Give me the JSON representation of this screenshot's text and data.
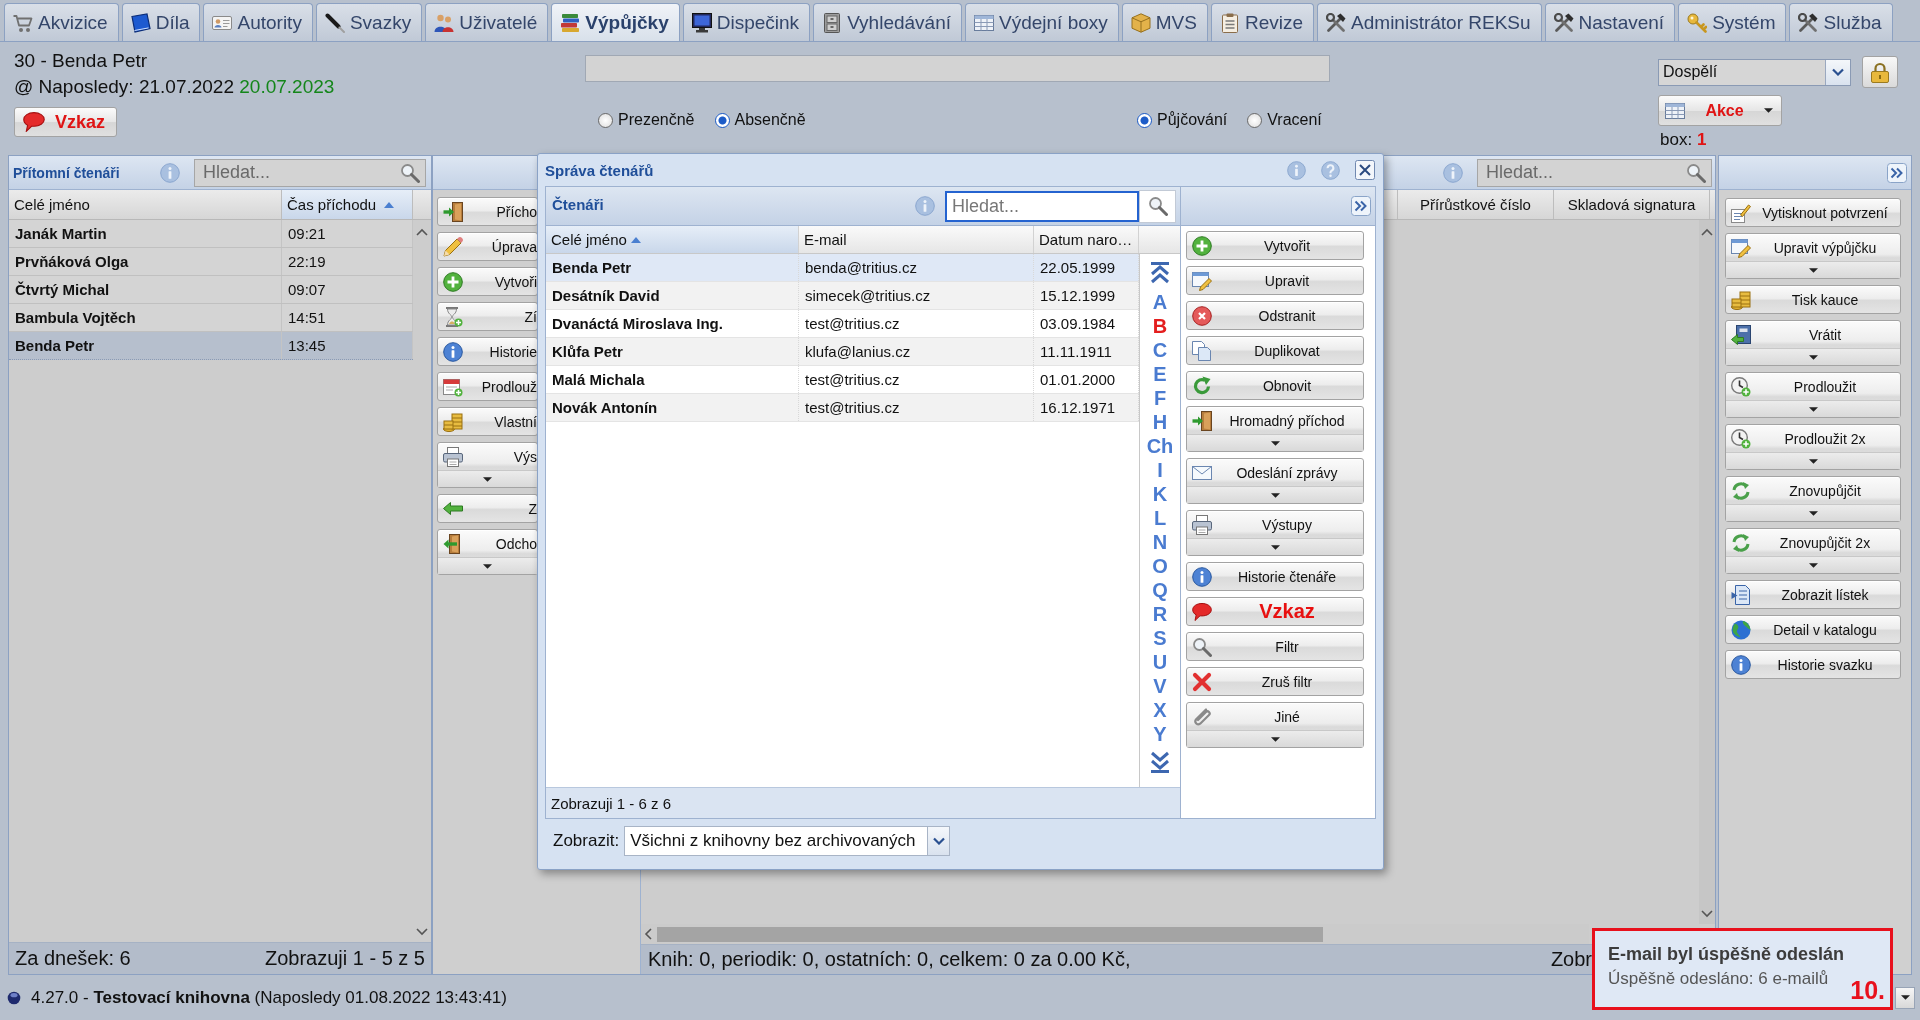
{
  "tabs": [
    {
      "label": "Akvizice",
      "selected": false
    },
    {
      "label": "Díla",
      "selected": false
    },
    {
      "label": "Autority",
      "selected": false
    },
    {
      "label": "Svazky",
      "selected": false
    },
    {
      "label": "Uživatelé",
      "selected": false
    },
    {
      "label": "Výpůjčky",
      "selected": true
    },
    {
      "label": "Dispečink",
      "selected": false
    },
    {
      "label": "Vyhledávání",
      "selected": false
    },
    {
      "label": "Výdejní boxy",
      "selected": false
    },
    {
      "label": "MVS",
      "selected": false
    },
    {
      "label": "Revize",
      "selected": false
    },
    {
      "label": "Administrátor REKSu",
      "selected": false
    },
    {
      "label": "Nastavení",
      "selected": false
    },
    {
      "label": "Systém",
      "selected": false
    },
    {
      "label": "Služba",
      "selected": false
    }
  ],
  "header": {
    "reader": "30 - Benda Petr",
    "last_visit": "@ Naposledy: 21.07.2022",
    "valid_until": "20.07.2023",
    "message_button": "Vzkaz",
    "loan_type": [
      {
        "label": "Prezenčně",
        "selected": false
      },
      {
        "label": "Absenčně",
        "selected": true
      }
    ],
    "mode": [
      {
        "label": "Půjčování",
        "selected": true
      },
      {
        "label": "Vracení",
        "selected": false
      }
    ],
    "category": "Dospělí",
    "actions_button": "Akce",
    "box_label": "box:",
    "box_count": "1"
  },
  "present_readers": {
    "title": "Přítomní čtenáři",
    "search_placeholder": "Hledat...",
    "columns": [
      {
        "label": "Celé jméno",
        "sorted": false
      },
      {
        "label": "Čas příchodu",
        "sorted": true
      }
    ],
    "rows": [
      {
        "name": "Janák Martin",
        "time": "09:21",
        "selected": false
      },
      {
        "name": "Prvňáková Olga",
        "time": "22:19",
        "selected": false
      },
      {
        "name": "Čtvrtý Michal",
        "time": "09:07",
        "selected": false
      },
      {
        "name": "Bambula Vojtěch",
        "time": "14:51",
        "selected": false
      },
      {
        "name": "Benda Petr",
        "time": "13:45",
        "selected": true
      }
    ],
    "today": "Za dnešek: 6",
    "paging": "Zobrazuji 1 - 5 z 5"
  },
  "reception_buttons": [
    {
      "label": "Přícho",
      "kind": "plain"
    },
    {
      "label": "Úprava",
      "kind": "plain"
    },
    {
      "label": "Vytvoři",
      "kind": "plain"
    },
    {
      "label": "Zí",
      "kind": "plain"
    },
    {
      "label": "Historie",
      "kind": "plain"
    },
    {
      "label": "Prodlouž",
      "kind": "plain"
    },
    {
      "label": "Vlastní",
      "kind": "plain"
    },
    {
      "label": "Výs",
      "kind": "split"
    },
    {
      "label": "Z",
      "kind": "plain"
    },
    {
      "label": "Odcho",
      "kind": "split"
    }
  ],
  "loans": {
    "search_placeholder": "Hledat...",
    "columns": [
      "Přírůstkové číslo",
      "Skladová signatura"
    ],
    "summary": "Knih: 0, periodik: 0, ostatních: 0, celkem: 0 za 0.00 Kč,",
    "paging": "Zobr"
  },
  "loan_buttons": [
    {
      "label": "Vytisknout potvrzení",
      "kind": "plain"
    },
    {
      "label": "Upravit výpůjčku",
      "kind": "split"
    },
    {
      "label": "Tisk kauce",
      "kind": "plain"
    },
    {
      "label": "Vrátit",
      "kind": "split"
    },
    {
      "label": "Prodloužit",
      "kind": "split"
    },
    {
      "label": "Prodloužit 2x",
      "kind": "split"
    },
    {
      "label": "Znovupůjčit",
      "kind": "split"
    },
    {
      "label": "Znovupůjčit 2x",
      "kind": "split"
    },
    {
      "label": "Zobrazit lístek",
      "kind": "plain"
    },
    {
      "label": "Detail v katalogu",
      "kind": "plain"
    },
    {
      "label": "Historie svazku",
      "kind": "plain"
    }
  ],
  "status_bar": {
    "text": "4.27.0 - **Testovací knihovna** (Naposledy 01.08.2022 13:43:41)"
  },
  "dialog": {
    "title": "Správa čtenářů",
    "panel_title": "Čtenáři",
    "search_placeholder": "Hledat...",
    "columns": [
      {
        "label": "Celé jméno",
        "sorted": true
      },
      {
        "label": "E-mail",
        "sorted": false
      },
      {
        "label": "Datum naro…",
        "sorted": false
      }
    ],
    "rows": [
      {
        "name": "Benda Petr",
        "email": "benda@tritius.cz",
        "birth_date": "22.05.1999",
        "selected": true
      },
      {
        "name": "Desátník David",
        "email": "simecek@tritius.cz",
        "birth_date": "15.12.1999",
        "selected": false
      },
      {
        "name": "Dvanáctá Miroslava Ing.",
        "email": "test@tritius.cz",
        "birth_date": "03.09.1984",
        "selected": false
      },
      {
        "name": "Klůfa Petr",
        "email": "klufa@lanius.cz",
        "birth_date": "11.11.1911",
        "selected": false
      },
      {
        "name": "Malá Michala",
        "email": "test@tritius.cz",
        "birth_date": "01.01.2000",
        "selected": false
      },
      {
        "name": "Novák Antonín",
        "email": "test@tritius.cz",
        "birth_date": "16.12.1971",
        "selected": false
      }
    ],
    "alphabet": [
      {
        "label": "A",
        "selected": false
      },
      {
        "label": "B",
        "selected": true
      },
      {
        "label": "C",
        "selected": false
      },
      {
        "label": "E",
        "selected": false
      },
      {
        "label": "F",
        "selected": false
      },
      {
        "label": "H",
        "selected": false
      },
      {
        "label": "Ch",
        "selected": false
      },
      {
        "label": "I",
        "selected": false
      },
      {
        "label": "K",
        "selected": false
      },
      {
        "label": "L",
        "selected": false
      },
      {
        "label": "N",
        "selected": false
      },
      {
        "label": "O",
        "selected": false
      },
      {
        "label": "Q",
        "selected": false
      },
      {
        "label": "R",
        "selected": false
      },
      {
        "label": "S",
        "selected": false
      },
      {
        "label": "U",
        "selected": false
      },
      {
        "label": "V",
        "selected": false
      },
      {
        "label": "X",
        "selected": false
      },
      {
        "label": "Y",
        "selected": false
      }
    ],
    "paging": "Zobrazuji 1 - 6 z 6",
    "filter_label": "Zobrazit:",
    "filter_value": "Všichni z knihovny bez archivovaných",
    "buttons": [
      {
        "label": "Vytvořit",
        "kind": "plain"
      },
      {
        "label": "Upravit",
        "kind": "plain"
      },
      {
        "label": "Odstranit",
        "kind": "plain"
      },
      {
        "label": "Duplikovat",
        "kind": "plain"
      },
      {
        "label": "Obnovit",
        "kind": "plain"
      },
      {
        "label": "Hromadný příchod",
        "kind": "split"
      },
      {
        "label": "Odeslání zprávy",
        "kind": "split"
      },
      {
        "label": "Výstupy",
        "kind": "split"
      },
      {
        "label": "Historie čtenáře",
        "kind": "plain"
      },
      {
        "label": "Vzkaz",
        "kind": "alert"
      },
      {
        "label": "Filtr",
        "kind": "plain"
      },
      {
        "label": "Zruš filtr",
        "kind": "plain"
      },
      {
        "label": "Jiné",
        "kind": "split"
      }
    ]
  },
  "notification": {
    "title": "E-mail byl úspěšně odeslán",
    "message": "Úspěšně odesláno: 6 e-mailů",
    "step": "10."
  }
}
